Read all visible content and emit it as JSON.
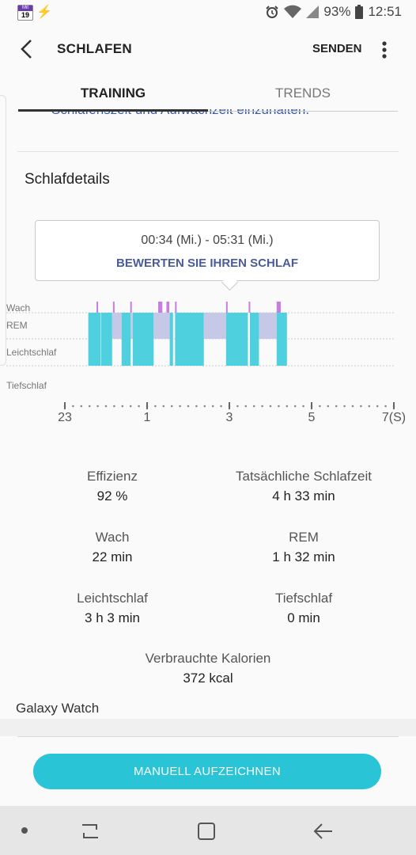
{
  "status_bar": {
    "calendar_day_label": "Mit",
    "calendar_date": "19",
    "battery_percent": "93%",
    "time": "12:51",
    "icons": [
      "calendar-icon",
      "lightning-icon",
      "alarm-icon",
      "wifi-icon",
      "signal-icon",
      "battery-icon"
    ]
  },
  "app_bar": {
    "title": "SCHLAFEN",
    "send_label": "SENDEN"
  },
  "tabs": [
    {
      "label": "TRAINING",
      "active": true
    },
    {
      "label": "TRENDS",
      "active": false
    }
  ],
  "partial_text": "Schlafenszeit und Aufwachzeit einzuhalten.",
  "sleep_details": {
    "title": "Schlafdetails",
    "tooltip_time": "00:34 (Mi.) - 05:31 (Mi.)",
    "tooltip_action": "BEWERTEN SIE IHREN SCHLAF"
  },
  "chart_data": {
    "type": "bar",
    "stages": [
      "Wach",
      "REM",
      "Leichtschlaf",
      "Tiefschlaf"
    ],
    "x_tick_labels": [
      "23",
      "1",
      "3",
      "5",
      "7(S)"
    ],
    "xlim": [
      23,
      31
    ],
    "colors": {
      "awake": "#c87de0",
      "rem": "#c5c8e6",
      "light": "#4fd0df"
    },
    "segments": [
      {
        "stage": "Leichtschlaf",
        "start": 0.57,
        "end": 0.87
      },
      {
        "stage": "Leichtschlaf",
        "start": 0.88,
        "end": 1.15
      },
      {
        "stage": "REM",
        "start": 1.15,
        "end": 1.38
      },
      {
        "stage": "Leichtschlaf",
        "start": 1.38,
        "end": 1.6
      },
      {
        "stage": "REM",
        "start": 1.6,
        "end": 1.65
      },
      {
        "stage": "Leichtschlaf",
        "start": 1.65,
        "end": 2.16
      },
      {
        "stage": "REM",
        "start": 2.16,
        "end": 2.55
      },
      {
        "stage": "Leichtschlaf",
        "start": 2.55,
        "end": 2.63
      },
      {
        "stage": "Leichtschlaf",
        "start": 2.68,
        "end": 3.38
      },
      {
        "stage": "REM",
        "start": 3.38,
        "end": 3.92
      },
      {
        "stage": "Leichtschlaf",
        "start": 3.92,
        "end": 4.45
      },
      {
        "stage": "Leichtschlaf",
        "start": 4.5,
        "end": 4.72
      },
      {
        "stage": "REM",
        "start": 4.72,
        "end": 5.15
      },
      {
        "stage": "Leichtschlaf",
        "start": 5.15,
        "end": 5.4
      }
    ],
    "awake_markers": [
      {
        "start": 0.77,
        "end": 0.79
      },
      {
        "start": 1.17,
        "end": 1.2
      },
      {
        "start": 1.59,
        "end": 1.62
      },
      {
        "start": 2.27,
        "end": 2.37
      },
      {
        "start": 2.47,
        "end": 2.54
      },
      {
        "start": 2.68,
        "end": 2.7
      },
      {
        "start": 3.92,
        "end": 3.94
      },
      {
        "start": 4.47,
        "end": 4.49
      },
      {
        "start": 5.15,
        "end": 5.25
      }
    ]
  },
  "stats": [
    {
      "label": "Effizienz",
      "value": "92 %"
    },
    {
      "label": "Tatsächliche Schlafzeit",
      "value": "4 h 33 min"
    },
    {
      "label": "Wach",
      "value": "22 min"
    },
    {
      "label": "REM",
      "value": "1 h 32 min"
    },
    {
      "label": "Leichtschlaf",
      "value": "3 h 3 min"
    },
    {
      "label": "Tiefschlaf",
      "value": "0 min"
    },
    {
      "label": "Verbrauchte Kalorien",
      "value": "372 kcal"
    }
  ],
  "source": "Galaxy Watch",
  "manual_button": "MANUELL AUFZEICHNEN",
  "nav_bar": {
    "icons": [
      "recents-icon",
      "home-icon",
      "back-icon"
    ]
  }
}
